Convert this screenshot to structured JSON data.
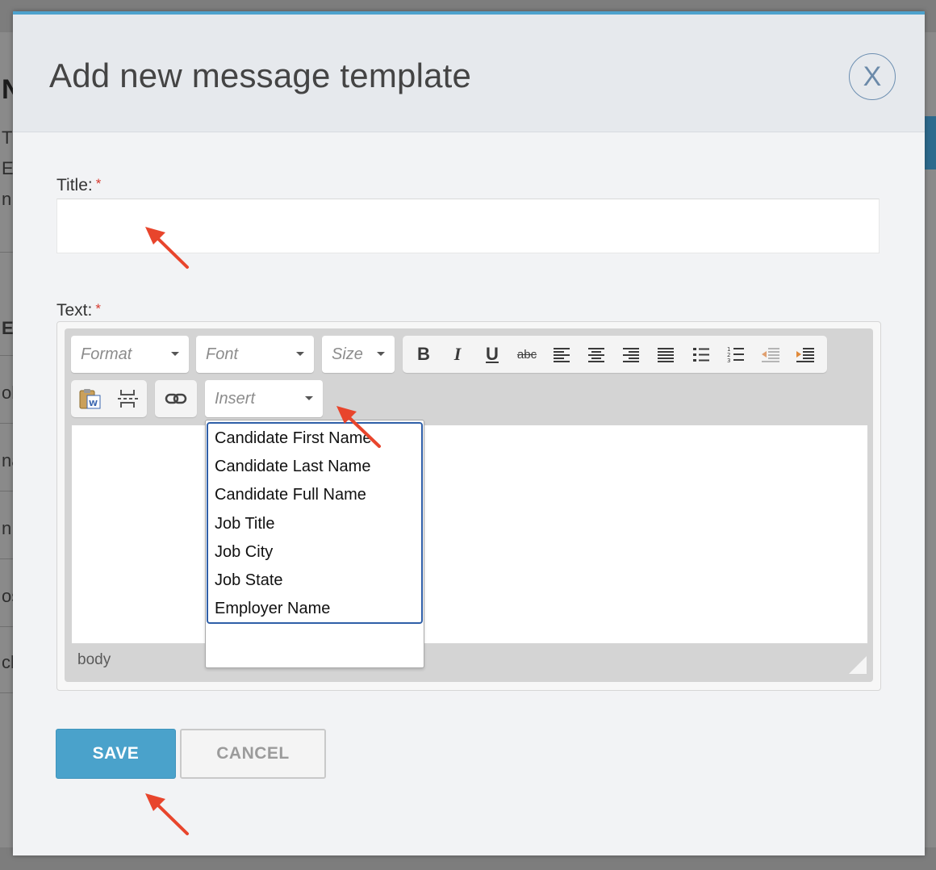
{
  "backdrop": {
    "fragments": [
      "N",
      "T",
      "E",
      "n",
      "EN",
      "ob",
      "na",
      "n",
      "os",
      "ch"
    ]
  },
  "modal": {
    "title": "Add new message template",
    "close_label": "X"
  },
  "form": {
    "title_label": "Title:",
    "title_required": "*",
    "title_value": "",
    "text_label": "Text:",
    "text_required": "*"
  },
  "editor": {
    "format_placeholder": "Format",
    "font_placeholder": "Font",
    "size_placeholder": "Size",
    "insert_placeholder": "Insert",
    "status_path": "body",
    "insert_options": [
      "Candidate First Name",
      "Candidate Last Name",
      "Candidate Full Name",
      "Job Title",
      "Job City",
      "Job State",
      "Employer Name"
    ]
  },
  "actions": {
    "save_label": "SAVE",
    "cancel_label": "CANCEL"
  },
  "colors": {
    "accent": "#4ea2cd",
    "save_button": "#4aa2cb",
    "required": "#d63a2f",
    "annotation_arrow": "#e8452c"
  },
  "icons": [
    "bold-icon",
    "italic-icon",
    "underline-icon",
    "strikethrough-icon",
    "align-left-icon",
    "align-center-icon",
    "align-right-icon",
    "align-justify-icon",
    "bulleted-list-icon",
    "numbered-list-icon",
    "outdent-icon",
    "indent-icon",
    "paste-from-word-icon",
    "page-break-icon",
    "link-icon"
  ]
}
